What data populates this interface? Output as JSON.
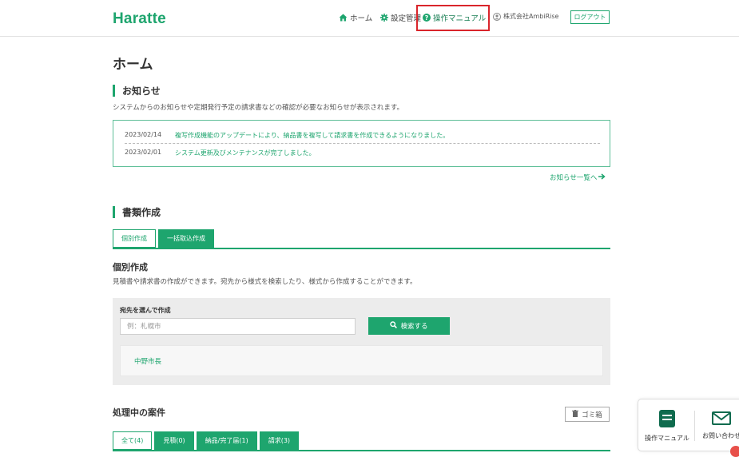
{
  "header": {
    "logo": "Haratte",
    "nav": {
      "home": "ホーム",
      "settings": "設定管理",
      "manual": "操作マニュアル",
      "company": "株式会社AmbiRise",
      "logout": "ログアウト"
    },
    "highlight_color": "#d9252b"
  },
  "page_title": "ホーム",
  "notices": {
    "heading": "お知らせ",
    "description": "システムからのお知らせや定期発行予定の請求書などの確認が必要なお知らせが表示されます。",
    "items": [
      {
        "date": "2023/02/14",
        "text": "複写作成機能のアップデートにより、納品書を複写して請求書を作成できるようになりました。"
      },
      {
        "date": "2023/02/01",
        "text": "システム更新及びメンテナンスが完了しました。"
      }
    ],
    "more_link": "お知らせ一覧へ"
  },
  "document": {
    "heading": "書類作成",
    "tabs": [
      "個別作成",
      "一括取込作成"
    ],
    "individual": {
      "title": "個別作成",
      "description": "見積書や請求書の作成ができます。宛先から様式を検索したり、様式から作成することができます。",
      "search_label": "宛先を選んで作成",
      "search_placeholder": "例：札幌市",
      "search_button": "検索する",
      "result": "中野市長"
    }
  },
  "cases": {
    "heading": "処理中の案件",
    "trash_button": "ゴミ箱",
    "tabs": [
      "全て(4)",
      "見積(0)",
      "納品/完了届(1)",
      "請求(3)"
    ]
  },
  "float_widget": {
    "manual": "操作マニュアル",
    "contact": "お問い合わせ"
  },
  "colors": {
    "brand": "#1ea56e",
    "brand_dark": "#0f6b4e"
  }
}
